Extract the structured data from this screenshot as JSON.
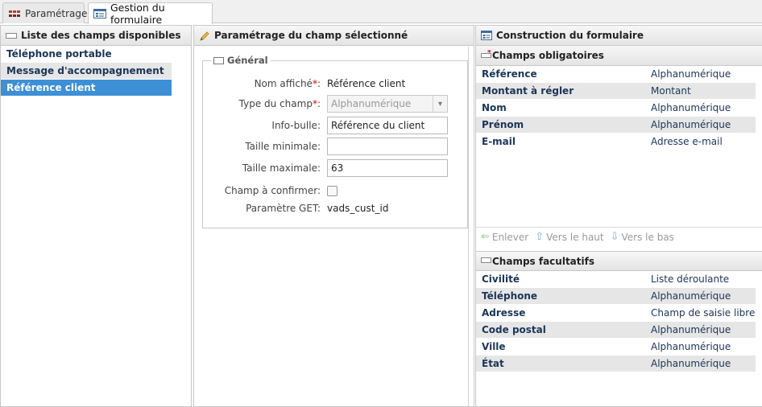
{
  "tabs": [
    {
      "label": "Paramétrage",
      "icon": "grid-icon"
    },
    {
      "label": "Gestion du formulaire",
      "icon": "form-icon"
    }
  ],
  "left_panel": {
    "title": "Liste des champs disponibles",
    "items": [
      {
        "label": "Téléphone portable"
      },
      {
        "label": "Message d'accompagnement"
      },
      {
        "label": "Référence client"
      }
    ]
  },
  "middle_panel": {
    "title": "Paramétrage du champ sélectionné",
    "fieldset_legend": "Général",
    "fields": {
      "display_name_label": "Nom affiché",
      "display_name_value": "Référence client",
      "type_label": "Type du champ",
      "type_value": "Alphanumérique",
      "tooltip_label": "Info-bulle",
      "tooltip_value": "Référence du client",
      "min_label": "Taille minimale",
      "min_value": "",
      "max_label": "Taille maximale",
      "max_value": "63",
      "confirm_label": "Champ à confirmer",
      "get_label": "Paramètre GET",
      "get_value": "vads_cust_id"
    },
    "required_marker": "*",
    "colon": ":"
  },
  "right_panel": {
    "title": "Construction du formulaire",
    "required_section": {
      "title": "Champs obligatoires",
      "rows": [
        {
          "name": "Référence",
          "type": "Alphanumérique"
        },
        {
          "name": "Montant à régler",
          "type": "Montant"
        },
        {
          "name": "Nom",
          "type": "Alphanumérique"
        },
        {
          "name": "Prénom",
          "type": "Alphanumérique"
        },
        {
          "name": "E-mail",
          "type": "Adresse e-mail"
        }
      ]
    },
    "toolbar": {
      "remove": "Enlever",
      "up": "Vers le haut",
      "down": "Vers le bas"
    },
    "optional_section": {
      "title": "Champs facultatifs",
      "rows": [
        {
          "name": "Civilité",
          "type": "Liste déroulante"
        },
        {
          "name": "Téléphone",
          "type": "Alphanumérique"
        },
        {
          "name": "Adresse",
          "type": "Champ de saisie libre"
        },
        {
          "name": "Code postal",
          "type": "Alphanumérique"
        },
        {
          "name": "Ville",
          "type": "Alphanumérique"
        },
        {
          "name": "État",
          "type": "Alphanumérique"
        }
      ]
    }
  }
}
